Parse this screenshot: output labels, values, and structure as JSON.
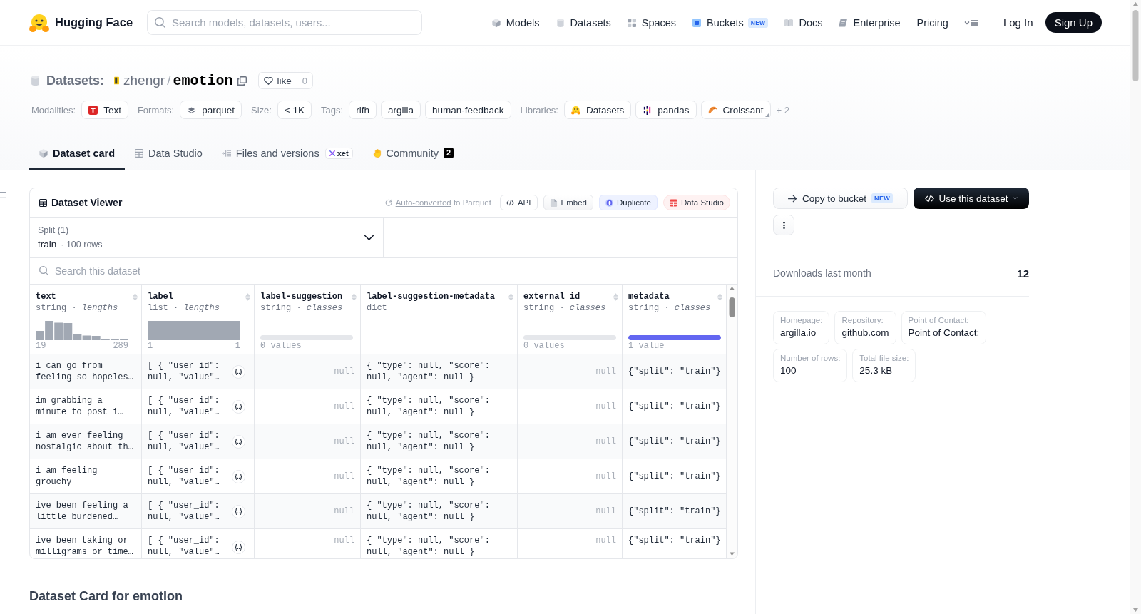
{
  "header": {
    "brand": "Hugging Face",
    "search": {
      "placeholder": "Search models, datasets, users..."
    },
    "nav": [
      {
        "label": "Models"
      },
      {
        "label": "Datasets"
      },
      {
        "label": "Spaces"
      },
      {
        "label": "Buckets",
        "badge": "NEW"
      },
      {
        "label": "Docs"
      },
      {
        "label": "Enterprise"
      },
      {
        "label": "Pricing"
      }
    ],
    "log_in": "Log In",
    "sign_up": "Sign Up"
  },
  "repo": {
    "type": "Datasets:",
    "owner": "zhengr",
    "separator": "/",
    "name": "emotion",
    "like": "like",
    "likes": "0"
  },
  "meta": [
    {
      "label": "Modalities:",
      "chips": [
        "Text"
      ]
    },
    {
      "label": "Formats:",
      "chips": [
        "parquet"
      ]
    },
    {
      "label": "Size:",
      "chips": [
        "< 1K"
      ]
    },
    {
      "label": "Tags:",
      "chips": [
        "rlfh",
        "argilla",
        "human-feedback"
      ]
    },
    {
      "label": "Libraries:",
      "chips": [
        "Datasets",
        "pandas",
        "Croissant"
      ],
      "more": "+ 2"
    }
  ],
  "tabs": [
    {
      "label": "Dataset card",
      "selected": true
    },
    {
      "label": "Data Studio",
      "selected": false
    },
    {
      "label": "Files and versions",
      "badge": "xet",
      "selected": false
    },
    {
      "label": "Community",
      "count": "2",
      "selected": false
    }
  ],
  "viewer": {
    "title": "Dataset Viewer",
    "note_link": "Auto-converted",
    "note_text": "to Parquet",
    "actions": [
      {
        "label": "API"
      },
      {
        "label": "Embed"
      },
      {
        "label": "Duplicate"
      },
      {
        "label": "Data Studio"
      }
    ],
    "split": {
      "label": "Split (1)",
      "value": "train",
      "rows": "· 100 rows"
    },
    "search": {
      "placeholder": "Search this dataset"
    },
    "columns": [
      {
        "name": "text",
        "type": "string · *lengths*",
        "kind": "histogram",
        "min": "19",
        "max": "289"
      },
      {
        "name": "label",
        "type": "list · *lengths*",
        "kind": "histogram",
        "min": "1",
        "max": "1"
      },
      {
        "name": "label-suggestion",
        "type": "string · *classes*",
        "kind": "classes",
        "count": "0 values"
      },
      {
        "name": "label-suggestion-metadata",
        "type": "dict",
        "kind": "plain"
      },
      {
        "name": "external_id",
        "type": "string · *classes*",
        "kind": "classes",
        "count": "0 values"
      },
      {
        "name": "metadata",
        "type": "string · *classes*",
        "kind": "classes",
        "level": 1,
        "count": "1 value"
      }
    ],
    "rows": [
      [
        {
          "kind": "text",
          "text": "i can go from feeling so hopeles…"
        },
        {
          "kind": "nested",
          "text": "[ { \"user_id\": null, \"value\"…"
        },
        {
          "kind": "null",
          "text": "null"
        },
        {
          "kind": "text",
          "text": "{ \"type\": null, \"score\": null, \"agent\": null }"
        },
        {
          "kind": "null",
          "text": "null"
        },
        {
          "kind": "text",
          "text": "{\"split\": \"train\"}"
        }
      ],
      [
        {
          "kind": "text",
          "text": "im grabbing a minute to post i…"
        },
        {
          "kind": "nested",
          "text": "[ { \"user_id\": null, \"value\"…"
        },
        {
          "kind": "null",
          "text": "null"
        },
        {
          "kind": "text",
          "text": "{ \"type\": null, \"score\": null, \"agent\": null }"
        },
        {
          "kind": "null",
          "text": "null"
        },
        {
          "kind": "text",
          "text": "{\"split\": \"train\"}"
        }
      ],
      [
        {
          "kind": "text",
          "text": "i am ever feeling nostalgic about th…"
        },
        {
          "kind": "nested",
          "text": "[ { \"user_id\": null, \"value\"…"
        },
        {
          "kind": "null",
          "text": "null"
        },
        {
          "kind": "text",
          "text": "{ \"type\": null, \"score\": null, \"agent\": null }"
        },
        {
          "kind": "null",
          "text": "null"
        },
        {
          "kind": "text",
          "text": "{\"split\": \"train\"}"
        }
      ],
      [
        {
          "kind": "text",
          "text": "i am feeling grouchy"
        },
        {
          "kind": "nested",
          "text": "[ { \"user_id\": null, \"value\"…"
        },
        {
          "kind": "null",
          "text": "null"
        },
        {
          "kind": "text",
          "text": "{ \"type\": null, \"score\": null, \"agent\": null }"
        },
        {
          "kind": "null",
          "text": "null"
        },
        {
          "kind": "text",
          "text": "{\"split\": \"train\"}"
        }
      ],
      [
        {
          "kind": "text",
          "text": "ive been feeling a little burdened…"
        },
        {
          "kind": "nested",
          "text": "[ { \"user_id\": null, \"value\"…"
        },
        {
          "kind": "null",
          "text": "null"
        },
        {
          "kind": "text",
          "text": "{ \"type\": null, \"score\": null, \"agent\": null }"
        },
        {
          "kind": "null",
          "text": "null"
        },
        {
          "kind": "text",
          "text": "{\"split\": \"train\"}"
        }
      ],
      [
        {
          "kind": "text",
          "text": "ive been taking or milligrams or time…"
        },
        {
          "kind": "nested",
          "text": "[ { \"user_id\": null, \"value\"…"
        },
        {
          "kind": "null",
          "text": "null"
        },
        {
          "kind": "text",
          "text": "{ \"type\": null, \"score\": null, \"agent\": null }"
        },
        {
          "kind": "null",
          "text": "null"
        },
        {
          "kind": "text",
          "text": "{\"split\": \"train\"}"
        }
      ]
    ]
  },
  "sidebar": {
    "copy": {
      "label": "Copy to bucket",
      "badge": "NEW"
    },
    "use": "Use this dataset",
    "downloads": {
      "label": "Downloads last month",
      "value": "12"
    },
    "info": [
      {
        "label": "Homepage:",
        "value": "argilla.io"
      },
      {
        "label": "Repository:",
        "value": "github.com"
      },
      {
        "label": "Point of Contact:",
        "value": "Point of Contact:"
      },
      {
        "label": "Number of rows:",
        "value": "100"
      },
      {
        "label": "Total file size:",
        "value": "25.3 kB"
      }
    ]
  },
  "card_heading": "Dataset Card for emotion"
}
